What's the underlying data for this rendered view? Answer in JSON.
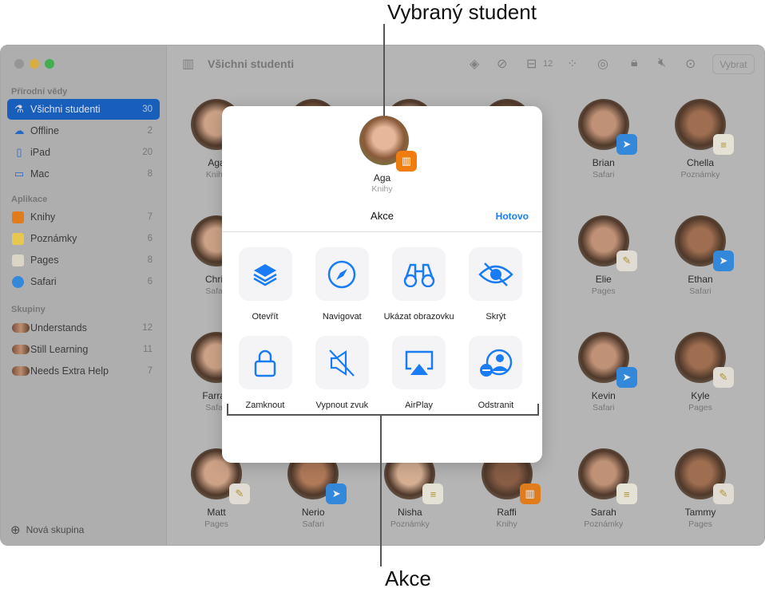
{
  "sidebar": {
    "section_class": "Přírodní vědy",
    "section_apps": "Aplikace",
    "section_groups": "Skupiny",
    "class_items": [
      {
        "icon": "microscope-icon",
        "glyph": "⚗",
        "label": "Všichni studenti",
        "count": "30",
        "selected": true
      },
      {
        "icon": "cloud-offline-icon",
        "glyph": "☁",
        "label": "Offline",
        "count": "2"
      },
      {
        "icon": "ipad-icon",
        "glyph": "▯",
        "label": "iPad",
        "count": "20"
      },
      {
        "icon": "mac-icon",
        "glyph": "▭",
        "label": "Mac",
        "count": "8"
      }
    ],
    "app_items": [
      {
        "icon": "books-app-icon",
        "color": "#f07d10",
        "label": "Knihy",
        "count": "7"
      },
      {
        "icon": "notes-app-icon",
        "color": "#f5d24a",
        "label": "Poznámky",
        "count": "6"
      },
      {
        "icon": "pages-app-icon",
        "color": "#e8e2d0",
        "label": "Pages",
        "count": "8"
      },
      {
        "icon": "safari-app-icon",
        "color": "#2a8ae8",
        "label": "Safari",
        "count": "6"
      }
    ],
    "group_items": [
      {
        "label": "Understands",
        "count": "12"
      },
      {
        "label": "Still Learning",
        "count": "11"
      },
      {
        "label": "Needs Extra Help",
        "count": "7"
      }
    ],
    "new_group": "Nová skupina"
  },
  "toolbar": {
    "title": "Všichni studenti",
    "inbox_count": "12",
    "select_label": "Vybrat"
  },
  "students": [
    {
      "name": "Aga",
      "app": "Knihy"
    },
    {
      "name": "",
      "app": ""
    },
    {
      "name": "",
      "app": ""
    },
    {
      "name": "",
      "app": ""
    },
    {
      "name": "Brian",
      "app": "Safari"
    },
    {
      "name": "Chella",
      "app": "Poznámky"
    },
    {
      "name": "Chris",
      "app": "Safari"
    },
    {
      "name": "",
      "app": ""
    },
    {
      "name": "",
      "app": ""
    },
    {
      "name": "",
      "app": ""
    },
    {
      "name": "Elie",
      "app": "Pages"
    },
    {
      "name": "Ethan",
      "app": "Safari"
    },
    {
      "name": "Farrah",
      "app": "Safari"
    },
    {
      "name": "",
      "app": ""
    },
    {
      "name": "",
      "app": ""
    },
    {
      "name": "",
      "app": ""
    },
    {
      "name": "Kevin",
      "app": "Safari"
    },
    {
      "name": "Kyle",
      "app": "Pages"
    },
    {
      "name": "Matt",
      "app": "Pages"
    },
    {
      "name": "Nerio",
      "app": "Safari"
    },
    {
      "name": "Nisha",
      "app": "Poznámky"
    },
    {
      "name": "Raffi",
      "app": "Knihy"
    },
    {
      "name": "Sarah",
      "app": "Poznámky"
    },
    {
      "name": "Tammy",
      "app": "Pages"
    }
  ],
  "modal": {
    "student_name": "Aga",
    "student_app": "Knihy",
    "title": "Akce",
    "done": "Hotovo",
    "actions": [
      {
        "icon": "layers-icon",
        "label": "Otevřít"
      },
      {
        "icon": "compass-icon",
        "label": "Navigovat"
      },
      {
        "icon": "binoculars-icon",
        "label": "Ukázat obrazovku"
      },
      {
        "icon": "eye-slash-icon",
        "label": "Skrýt"
      },
      {
        "icon": "lock-icon",
        "label": "Zamknout"
      },
      {
        "icon": "speaker-mute-icon",
        "label": "Vypnout zvuk"
      },
      {
        "icon": "airplay-icon",
        "label": "AirPlay"
      },
      {
        "icon": "person-remove-icon",
        "label": "Odstranit"
      }
    ]
  },
  "callouts": {
    "selected_student": "Vybraný student",
    "actions": "Akce"
  },
  "colors": {
    "accent": "#1a7cf5",
    "selection": "#0b5cc5"
  }
}
